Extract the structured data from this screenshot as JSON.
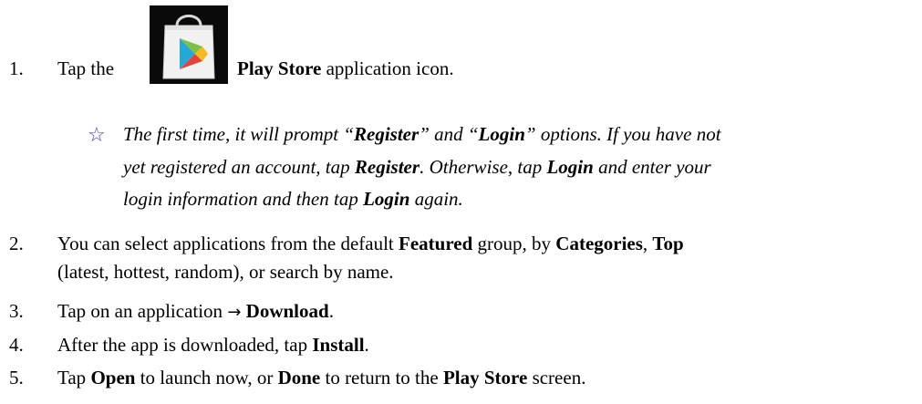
{
  "step1": {
    "number": "1.",
    "prefix": "Tap the",
    "app_name": "Play Store",
    "suffix": " application icon.",
    "icon": "play-store-bag-icon"
  },
  "note": {
    "icon": "star-outline-icon",
    "line1": {
      "t1": "The first time, it will prompt “",
      "b1": "Register",
      "t2": "” and “",
      "b2": "Login",
      "t3": "” options. If you have not"
    },
    "line2": {
      "t1": "yet registered an account, tap ",
      "b1": "Register",
      "t2": ". Otherwise, tap ",
      "b2": "Login",
      "t3": " and enter your"
    },
    "line3": {
      "t1": "login information and then tap ",
      "b1": "Login",
      "t2": " again."
    }
  },
  "step2": {
    "number": "2.",
    "line1": {
      "t1": "You can select applications from the default ",
      "b1": "Featured",
      "t2": " group, by ",
      "b2": "Categories",
      "t3": ", ",
      "b3": "Top"
    },
    "line2": "(latest, hottest, random), or search by name."
  },
  "step3": {
    "number": "3.",
    "t1": "Tap on an application ",
    "arrow": "→",
    "b1": "Download",
    "t2": "."
  },
  "step4": {
    "number": "4.",
    "t1": "After the app is downloaded, tap ",
    "b1": "Install",
    "t2": "."
  },
  "step5": {
    "number": "5.",
    "t1": "Tap ",
    "b1": "Open",
    "t2": " to launch now, or ",
    "b2": "Done",
    "t3": " to return to the ",
    "b3": "Play Store",
    "t4": " screen."
  }
}
